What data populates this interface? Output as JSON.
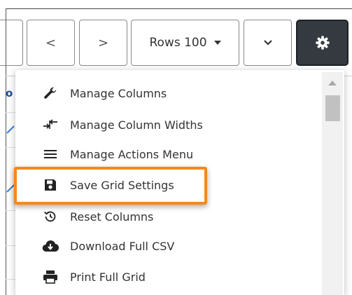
{
  "toolbar": {
    "prev_label": "<",
    "next_label": ">",
    "rows_label": "Rows 100",
    "gear_icon": "gear-icon"
  },
  "menu": {
    "items": [
      {
        "label": "Manage Columns",
        "icon": "wrench-icon"
      },
      {
        "label": "Manage Column Widths",
        "icon": "column-width-icon"
      },
      {
        "label": "Manage Actions Menu",
        "icon": "hamburger-icon"
      },
      {
        "label": "Save Grid Settings",
        "icon": "floppy-disk-icon"
      },
      {
        "label": "Reset Columns",
        "icon": "history-icon"
      },
      {
        "label": "Download Full CSV",
        "icon": "cloud-download-icon"
      },
      {
        "label": "Print Full Grid",
        "icon": "printer-icon"
      }
    ],
    "highlighted_item": "Save Grid Settings",
    "highlight_color": "#f28a1d"
  },
  "background": {
    "link_fragment": "o"
  }
}
